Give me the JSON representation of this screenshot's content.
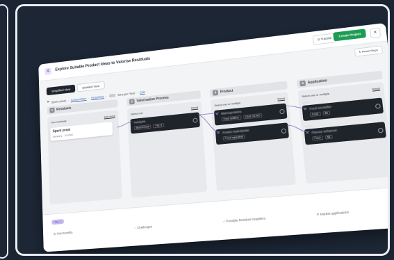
{
  "header": {
    "title": "Explore Suitable Product Ideas to Valorise Residuals",
    "tutorial": "Tutorial",
    "create": "Create Project",
    "close": "×"
  },
  "reset_steps": "Reset Steps",
  "tabs": [
    "Simplified View",
    "Detailed View"
  ],
  "breadcrumb": {
    "a": "Spent yeast",
    "b": "Composition",
    "c": "Properties",
    "d": "Tons per Year",
    "e": "Edit"
  },
  "columns": {
    "residuals": {
      "num": "1",
      "title": "Residuals",
      "sub": "Your residuals",
      "link": "Add more",
      "item": {
        "title": "Spent yeast",
        "meta": "Brewery · 10,000t"
      }
    },
    "process": {
      "num": "2",
      "title": "Valorisation Process",
      "sub": "Select one",
      "link": "Reset",
      "item": {
        "title": "Autolysis",
        "tag1": "Biochemical",
        "tag2": "TRL 6"
      }
    },
    "product": {
      "num": "3",
      "title": "Product",
      "sub": "Select one or multiple",
      "link": "Reset",
      "items": [
        {
          "title": "Mannoproteins",
          "tag1": "Food additive",
          "tag2": "GMS 15,000"
        },
        {
          "title": "Protein hydrolysate",
          "tag1": "Food ingredient",
          "tag2": ""
        }
      ]
    },
    "application": {
      "num": "4",
      "title": "Application",
      "sub": "Select one or multiple",
      "link": "Reset",
      "items": [
        {
          "title": "Food emulsifier",
          "tag1": "Food",
          "tag2": "$$"
        },
        {
          "title": "Flavour enhancer",
          "tag1": "Food",
          "tag2": "$$"
        }
      ]
    }
  },
  "footer": {
    "trl": "TRL 7",
    "benefits": "Key benefits",
    "challenges": "Challenges",
    "suppliers": "Possible Residual Suppliers",
    "market": "Market applications"
  }
}
